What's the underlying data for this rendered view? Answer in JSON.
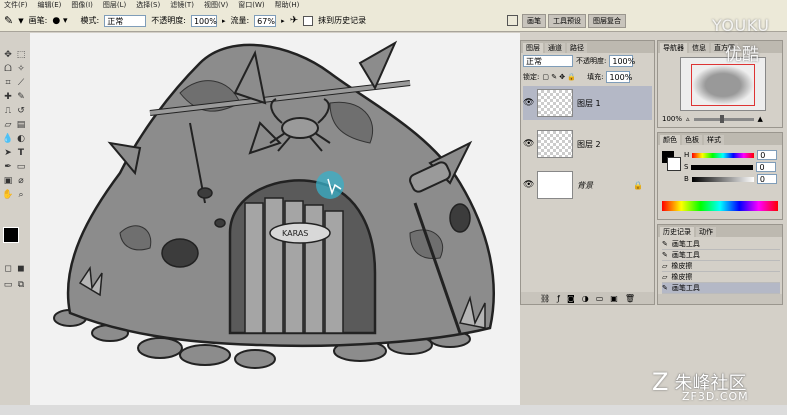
{
  "menu": [
    "文件(F)",
    "编辑(E)",
    "图像(I)",
    "图层(L)",
    "选择(S)",
    "滤镜(T)",
    "视图(V)",
    "窗口(W)",
    "帮助(H)"
  ],
  "options": {
    "brush_label": "画笔:",
    "mode_label": "模式:",
    "mode_value": "正常",
    "opacity_label": "不透明度:",
    "opacity_value": "100%",
    "flow_label": "流量:",
    "flow_value": "67%",
    "history_label": "抹到历史记录"
  },
  "top_tabs": [
    "画笔",
    "工具预设",
    "图层复合"
  ],
  "layers_panel": {
    "tabs": [
      "图层",
      "通道",
      "路径"
    ],
    "blend_mode": "正常",
    "opacity_label": "不透明度:",
    "opacity_value": "100%",
    "lock_label": "锁定:",
    "fill_label": "填充:",
    "fill_value": "100%",
    "layers": [
      {
        "name": "图层 1"
      },
      {
        "name": "图层 2"
      },
      {
        "name": "背景"
      }
    ]
  },
  "navigator": {
    "tabs": [
      "导航器",
      "信息",
      "直方图"
    ],
    "zoom": "100%"
  },
  "color_panel": {
    "tabs": [
      "颜色",
      "色板",
      "样式"
    ],
    "h_label": "H",
    "s_label": "S",
    "b_label": "B",
    "h_value": "0",
    "s_value": "0",
    "b_value": "0"
  },
  "history_panel": {
    "tabs": [
      "历史记录",
      "动作"
    ],
    "items": [
      "画笔工具",
      "画笔工具",
      "橡皮擦",
      "橡皮擦",
      "画笔工具"
    ]
  },
  "canvas": {
    "sign_text": "KARAS"
  },
  "watermark": {
    "youku_en": "YOUKU",
    "youku_cn": "优酷",
    "site_cn": "朱峰社区",
    "site_en": "ZF3D.COM"
  },
  "colors": {
    "chrome": "#d4d0c8",
    "canvas": "#f2f2f2",
    "sketch_fill": "#8c8c8c",
    "highlight": "#38b0c8"
  }
}
